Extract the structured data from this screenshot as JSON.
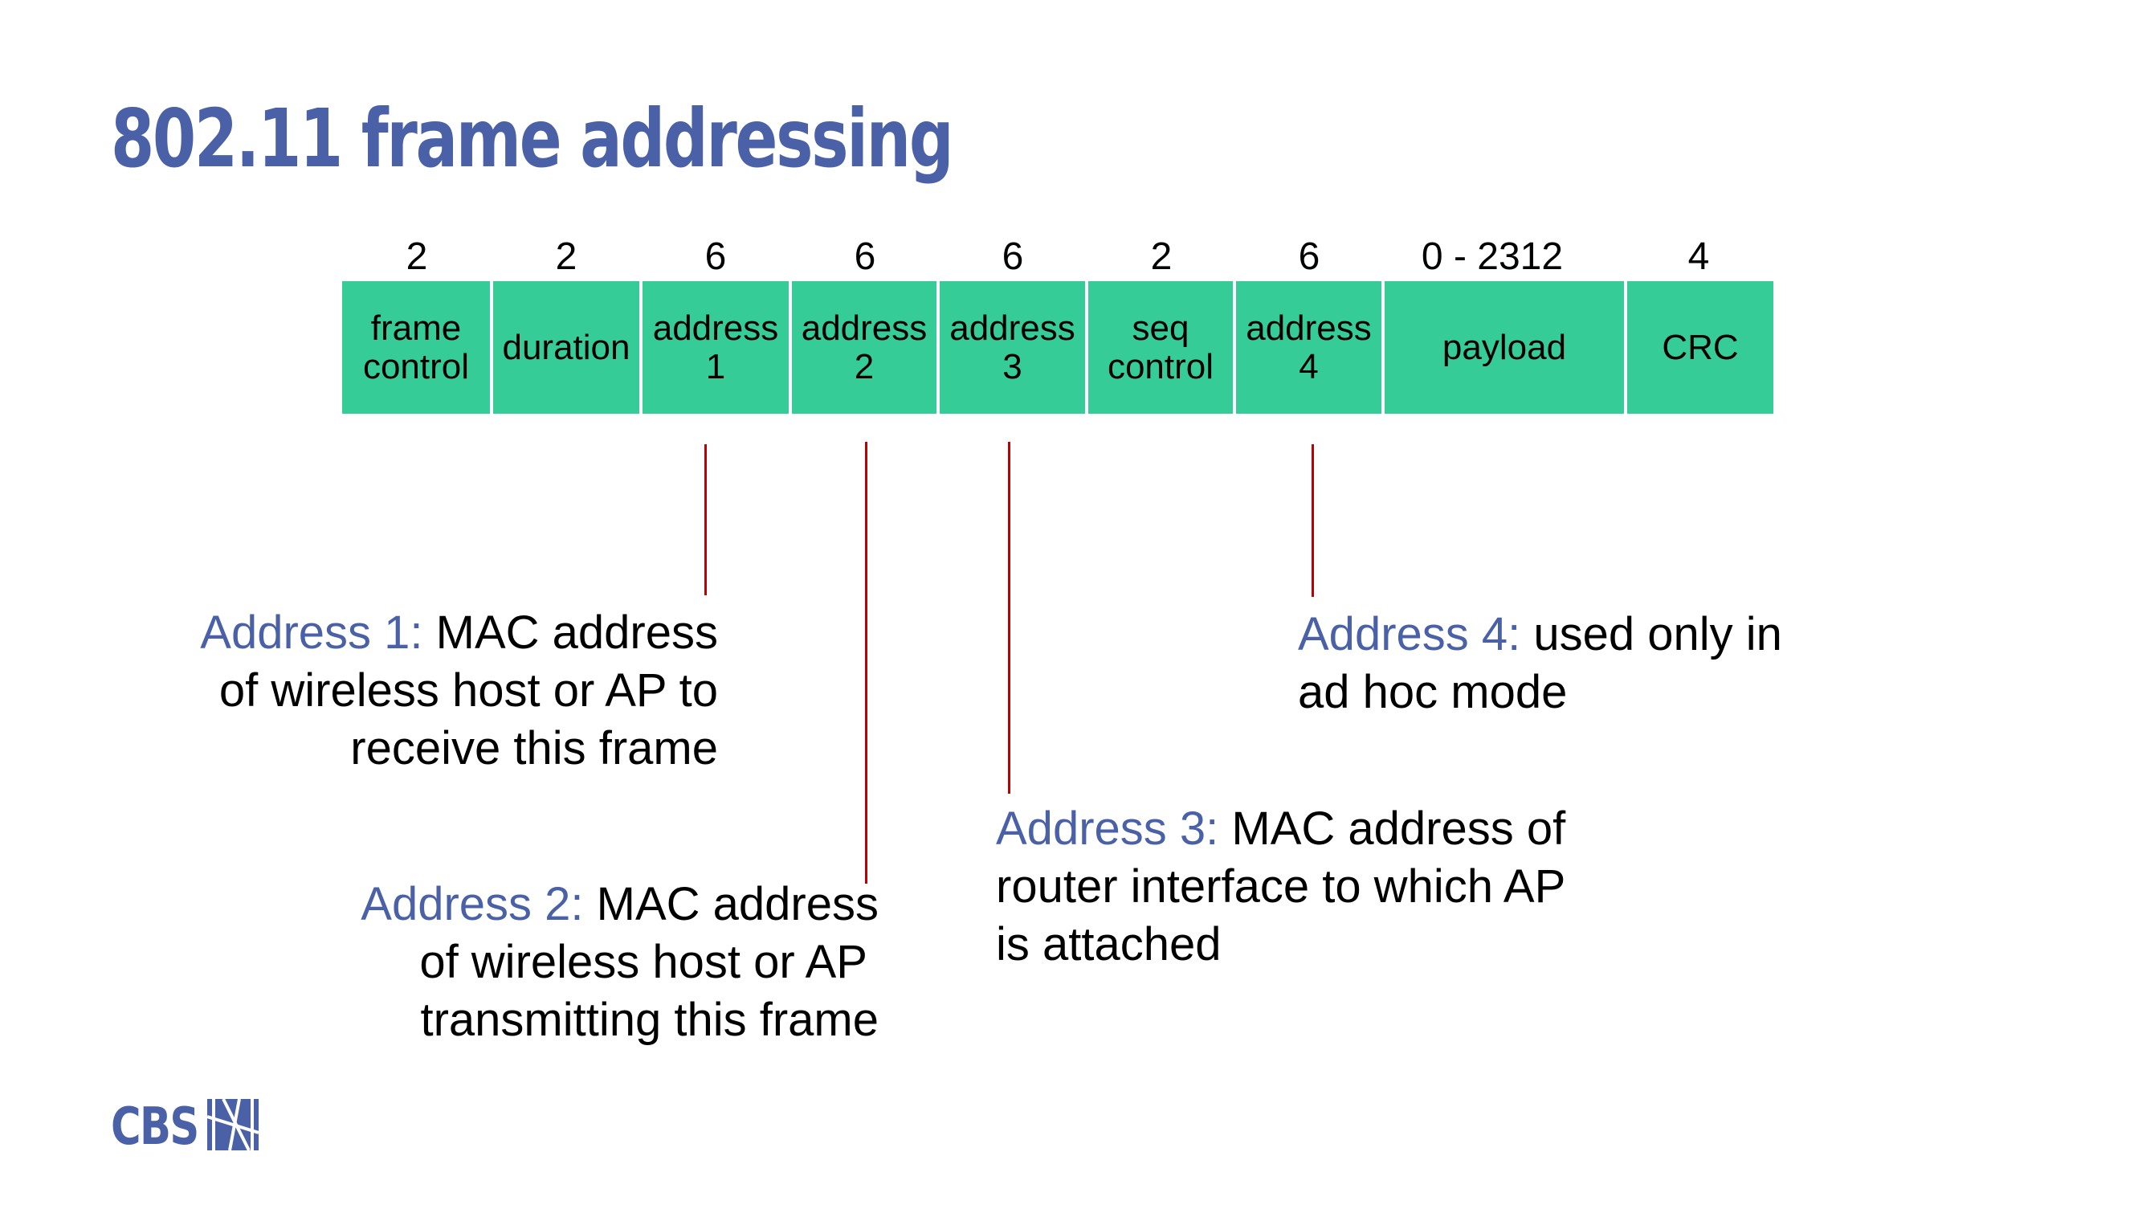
{
  "title": "802.11 frame addressing",
  "frame_fields": [
    {
      "size": "2",
      "label": "frame\ncontrol"
    },
    {
      "size": "2",
      "label": "duration"
    },
    {
      "size": "6",
      "label": "address\n1"
    },
    {
      "size": "6",
      "label": "address\n2"
    },
    {
      "size": "6",
      "label": "address\n3"
    },
    {
      "size": "2",
      "label": "seq\ncontrol"
    },
    {
      "size": "6",
      "label": "address\n4"
    },
    {
      "size": "0 - 2312",
      "label": "payload"
    },
    {
      "size": "4",
      "label": "CRC"
    }
  ],
  "descriptions": {
    "address1": {
      "label": "Address 1:",
      "line1": " MAC address",
      "line2": "of wireless host or AP  to",
      "line3": "receive this frame"
    },
    "address2": {
      "label": "Address 2:",
      "line1": " MAC address",
      "line2": "of wireless host or AP",
      "line3": "transmitting this frame"
    },
    "address3": {
      "label": "Address 3:",
      "line1": " MAC address of",
      "line2": "router interface to which AP",
      "line3": "is attached"
    },
    "address4": {
      "label": "Address 4:",
      "line1": " used only in",
      "line2": "ad hoc mode"
    }
  },
  "logo": {
    "text": "CBS",
    "icon": "cbs-logo-icon"
  },
  "colors": {
    "accent": "#4A61A8",
    "field_fill": "#36CC98",
    "pointer_line": "#C00000"
  }
}
